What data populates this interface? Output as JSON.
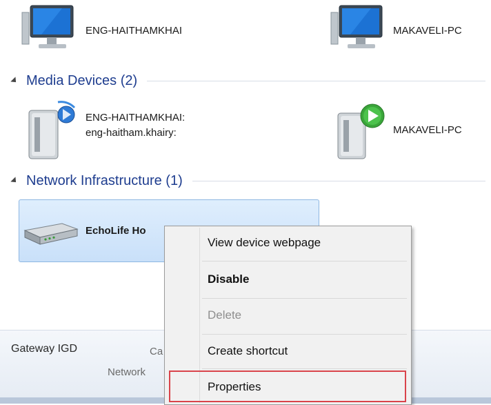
{
  "computers": [
    {
      "label": "ENG-HAITHAMKHAI"
    },
    {
      "label": "MAKAVELI-PC"
    }
  ],
  "media_group": {
    "title": "Media Devices (2)"
  },
  "media_devices": [
    {
      "line1": "ENG-HAITHAMKHAI:",
      "line2": "eng-haitham.khairy:"
    },
    {
      "line1": "MAKAVELI-PC"
    }
  ],
  "infra_group": {
    "title": "Network Infrastructure (1)"
  },
  "infra_devices": [
    {
      "label": "EchoLife Ho"
    }
  ],
  "details": {
    "name": "Gateway IGD",
    "category_partial": "Ca",
    "network_partial": "Network"
  },
  "context_menu": {
    "items": [
      {
        "label": "View device webpage",
        "style": "normal"
      },
      {
        "label": "Disable",
        "style": "bold"
      },
      {
        "label": "Delete",
        "style": "disabled"
      },
      {
        "label": "Create shortcut",
        "style": "normal"
      },
      {
        "label": "Properties",
        "style": "highlighted"
      }
    ]
  },
  "colors": {
    "group_header": "#1e3d8f",
    "selection_fill": "#c9e0f9",
    "highlight_border": "#d9434a"
  }
}
